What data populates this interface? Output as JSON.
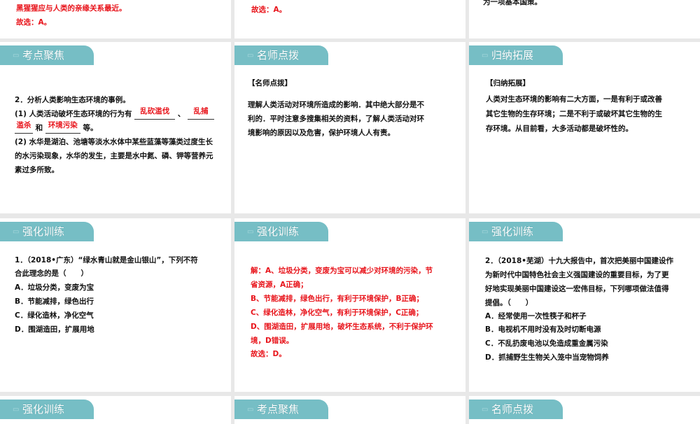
{
  "row0": {
    "col1": {
      "lines": [
        "黑猩猩应与人类的亲缘关系最近。",
        "故选：A。"
      ]
    },
    "col2": {
      "lines": [
        "故选：A。"
      ]
    },
    "col3": {
      "lines": [
        "为一项基本国策。"
      ]
    }
  },
  "row1": {
    "col1": {
      "tab": "考点聚焦",
      "q_title": "2．分析人类影响生态环境的事例。",
      "q1_prefix": "(1) 人类活动破坏生态环境的行为有",
      "blank1": "乱砍滥伐",
      "sep1": "、",
      "blank2a": "乱捕",
      "blank2b": "滥杀",
      "and": "和",
      "blank3": "环境污染",
      "suffix": "等。",
      "q2_lines": [
        "(2) 水华是湖泊、池塘等淡水水体中某些蓝藻等藻类过度生长",
        "的水污染现象，水华的发生，主要是水中氮、磷、钾等营养元",
        "素过多所致。"
      ]
    },
    "col2": {
      "tab": "名师点拨",
      "heading": "【名师点拨】",
      "lines": [
        "理解人类活动对环境所造成的影响．其中绝大部分是不",
        "利的．平时注意多搜集相关的资料，了解人类活动对环",
        "境影响的原因以及危害，保护环境人人有责。"
      ]
    },
    "col3": {
      "tab": "归纳拓展",
      "heading": "【归纳拓展】",
      "lines": [
        "人类对生态环境的影响有二大方面，一是有利于或改善",
        "其它生物的生存环境；二是不利于或破坏其它生物的生",
        "存环境。从目前看，大多活动都是破坏性的。"
      ]
    }
  },
  "row2": {
    "col1": {
      "tab": "强化训练",
      "lines": [
        "1．（2018•广东）“绿水青山就是金山银山”，下列不符",
        "合此理念的是（　　）",
        "A．垃圾分类，变废为宝",
        "B．节能减排，绿色出行",
        "C．绿化造林，净化空气",
        "D．围湖造田，扩展用地"
      ]
    },
    "col2": {
      "tab": "强化训练",
      "lines": [
        "解：A、垃圾分类，变废为宝可以减少对环境的污染，节",
        "省资源，A正确；",
        "B、节能减排，绿色出行，有利于环境保护，B正确；",
        "C、绿化造林，净化空气，有利于环境保护，C正确；",
        "D、围湖造田，扩展用地，破坏生态系统，不利于保护环",
        "境，D错误。",
        "故选：D。"
      ]
    },
    "col3": {
      "tab": "强化训练",
      "lines": [
        "2．（2018•芜湖）十九大报告中，首次把美丽中国建设作",
        "为新时代中国特色社会主义强国建设的重要目标，为了更",
        "好地实现美丽中国建设这一宏伟目标，下列哪项做法值得",
        "提倡。（　　）",
        "A．经常使用一次性筷子和杯子",
        "B．电视机不用时没有及时切断电源",
        "C．不乱扔废电池以免造成重金属污染",
        "D．抓捕野生生物关入笼中当宠物饲养"
      ]
    }
  },
  "row3": {
    "col1": {
      "tab": "强化训练"
    },
    "col2": {
      "tab": "考点聚焦"
    },
    "col3": {
      "tab": "名师点拨"
    }
  },
  "colors": {
    "tab": "#76bec5",
    "answer": "#e8141b"
  }
}
